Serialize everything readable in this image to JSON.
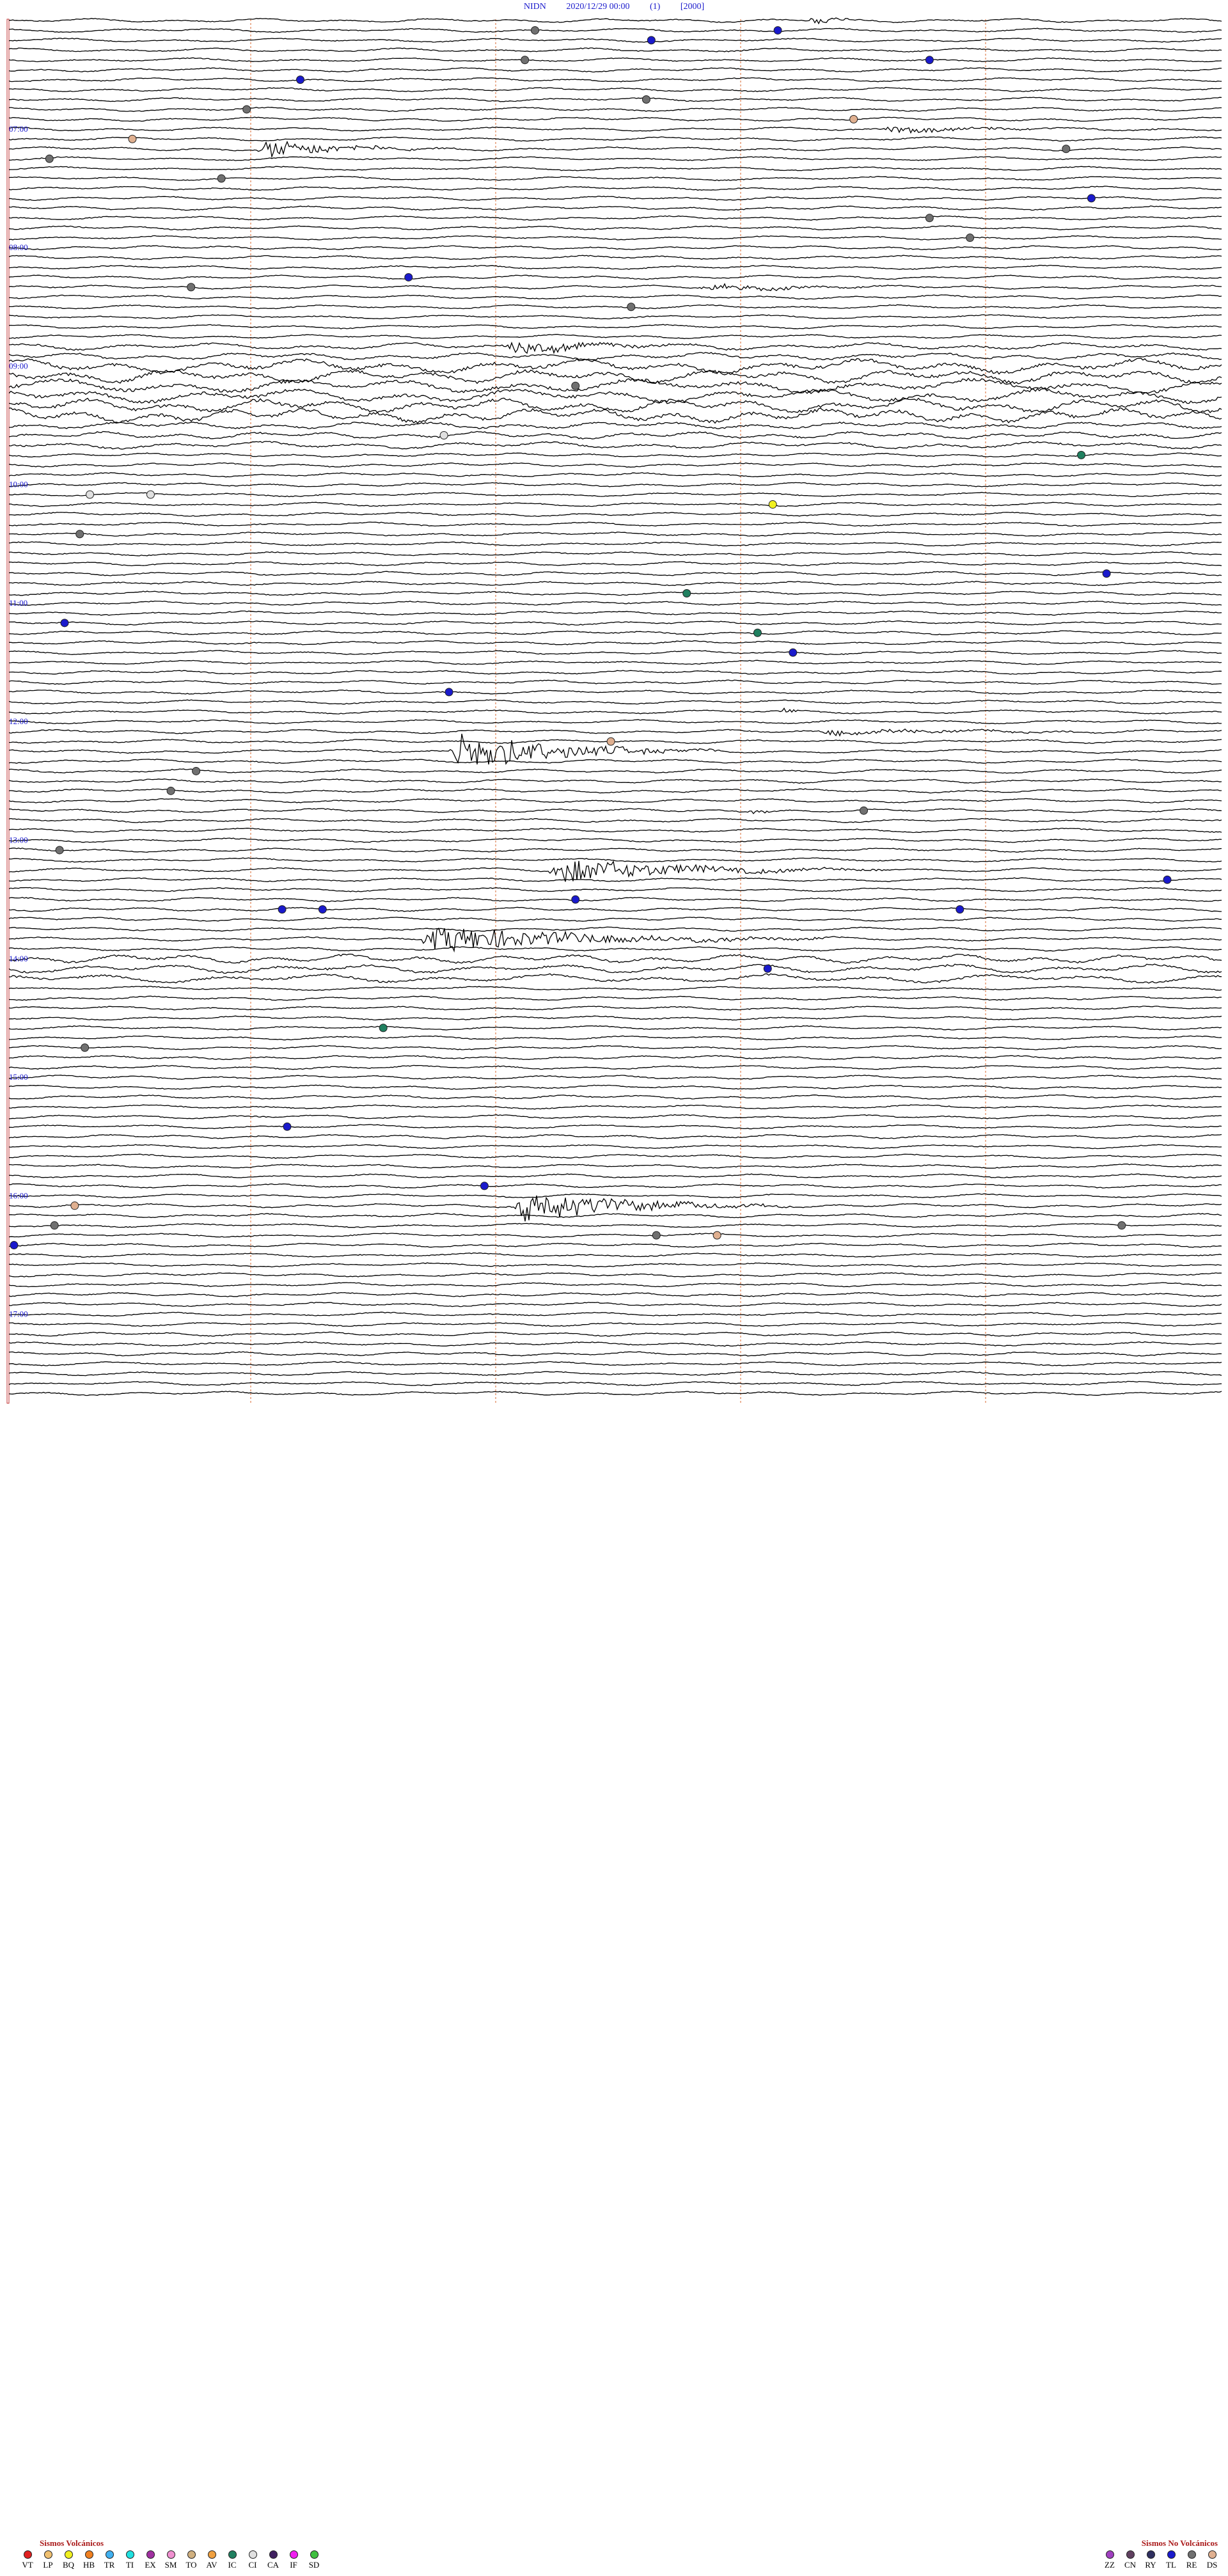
{
  "header": {
    "station": "NIDN",
    "datetime": "2020/12/29 00:00",
    "channel": "(1)",
    "scale": "[2000]"
  },
  "hour_labels": [
    {
      "label": "07:00",
      "row": 11
    },
    {
      "label": "08:00",
      "row": 23
    },
    {
      "label": "09:00",
      "row": 35
    },
    {
      "label": "10:00",
      "row": 47
    },
    {
      "label": "11:00",
      "row": 59
    },
    {
      "label": "12:00",
      "row": 71
    },
    {
      "label": "13:00",
      "row": 83
    },
    {
      "label": "14:00",
      "row": 95
    },
    {
      "label": "15:00",
      "row": 107
    },
    {
      "label": "16:00",
      "row": 119
    },
    {
      "label": "17:00",
      "row": 131
    }
  ],
  "legend": {
    "volcanic": {
      "title": "Sismos Volcánicos",
      "items": [
        {
          "code": "VT",
          "color": "#e02020"
        },
        {
          "code": "LP",
          "color": "#f0c070"
        },
        {
          "code": "BQ",
          "color": "#f0f020"
        },
        {
          "code": "HB",
          "color": "#f08020"
        },
        {
          "code": "TR",
          "color": "#40b0f0"
        },
        {
          "code": "TI",
          "color": "#20e0e0"
        },
        {
          "code": "EX",
          "color": "#a030a0"
        },
        {
          "code": "SM",
          "color": "#f090d0"
        },
        {
          "code": "TO",
          "color": "#d0b080"
        },
        {
          "code": "AV",
          "color": "#f0a040"
        },
        {
          "code": "IC",
          "color": "#208060"
        },
        {
          "code": "CI",
          "color": "#e0e0e0"
        },
        {
          "code": "CA",
          "color": "#402060"
        },
        {
          "code": "IF",
          "color": "#f020f0"
        },
        {
          "code": "SD",
          "color": "#40c040"
        }
      ]
    },
    "non_volcanic": {
      "title": "Sismos No Volcánicos",
      "items": [
        {
          "code": "ZZ",
          "color": "#a040c0"
        },
        {
          "code": "CN",
          "color": "#604060"
        },
        {
          "code": "RY",
          "color": "#303060"
        },
        {
          "code": "TL",
          "color": "#1a1acc"
        },
        {
          "code": "RE",
          "color": "#707070"
        },
        {
          "code": "DS",
          "color": "#e0b090"
        }
      ]
    }
  },
  "markers": [
    {
      "row": 1,
      "minute": 52.0,
      "type": "RE"
    },
    {
      "row": 1,
      "minute": 76.0,
      "type": "TL"
    },
    {
      "row": 2,
      "minute": 63.5,
      "type": "TL"
    },
    {
      "row": 4,
      "minute": 51.0,
      "type": "RE"
    },
    {
      "row": 4,
      "minute": 91.0,
      "type": "TL"
    },
    {
      "row": 6,
      "minute": 28.8,
      "type": "TL"
    },
    {
      "row": 8,
      "minute": 63.0,
      "type": "RE"
    },
    {
      "row": 9,
      "minute": 23.5,
      "type": "RE"
    },
    {
      "row": 10,
      "minute": 83.5,
      "type": "DS"
    },
    {
      "row": 12,
      "minute": 12.2,
      "type": "DS"
    },
    {
      "row": 13,
      "minute": 104.5,
      "type": "RE"
    },
    {
      "row": 14,
      "minute": 4.0,
      "type": "RE"
    },
    {
      "row": 16,
      "minute": 21.0,
      "type": "RE"
    },
    {
      "row": 18,
      "minute": 107.0,
      "type": "TL"
    },
    {
      "row": 20,
      "minute": 91.0,
      "type": "RE"
    },
    {
      "row": 22,
      "minute": 95.0,
      "type": "RE"
    },
    {
      "row": 26,
      "minute": 39.5,
      "type": "TL"
    },
    {
      "row": 27,
      "minute": 18.0,
      "type": "RE"
    },
    {
      "row": 29,
      "minute": 61.5,
      "type": "RE"
    },
    {
      "row": 37,
      "minute": 56.0,
      "type": "RE"
    },
    {
      "row": 42,
      "minute": 43.0,
      "type": "CI"
    },
    {
      "row": 44,
      "minute": 106.0,
      "type": "IC"
    },
    {
      "row": 48,
      "minute": 8.0,
      "type": "CI"
    },
    {
      "row": 48,
      "minute": 14.0,
      "type": "CI"
    },
    {
      "row": 49,
      "minute": 75.5,
      "type": "BQ"
    },
    {
      "row": 52,
      "minute": 7.0,
      "type": "RE"
    },
    {
      "row": 56,
      "minute": 108.5,
      "type": "TL"
    },
    {
      "row": 58,
      "minute": 67.0,
      "type": "IC"
    },
    {
      "row": 61,
      "minute": 5.5,
      "type": "TL"
    },
    {
      "row": 62,
      "minute": 74.0,
      "type": "IC"
    },
    {
      "row": 64,
      "minute": 77.5,
      "type": "TL"
    },
    {
      "row": 68,
      "minute": 43.5,
      "type": "TL"
    },
    {
      "row": 73,
      "minute": 59.5,
      "type": "DS"
    },
    {
      "row": 76,
      "minute": 18.5,
      "type": "RE"
    },
    {
      "row": 78,
      "minute": 16.0,
      "type": "RE"
    },
    {
      "row": 80,
      "minute": 84.5,
      "type": "RE"
    },
    {
      "row": 84,
      "minute": 5.0,
      "type": "RE"
    },
    {
      "row": 87,
      "minute": 114.5,
      "type": "TL"
    },
    {
      "row": 89,
      "minute": 56.0,
      "type": "TL"
    },
    {
      "row": 90,
      "minute": 27.0,
      "type": "TL"
    },
    {
      "row": 90,
      "minute": 31.0,
      "type": "TL"
    },
    {
      "row": 90,
      "minute": 94.0,
      "type": "TL"
    },
    {
      "row": 96,
      "minute": 75.0,
      "type": "TL"
    },
    {
      "row": 102,
      "minute": 37.0,
      "type": "IC"
    },
    {
      "row": 104,
      "minute": 7.5,
      "type": "RE"
    },
    {
      "row": 112,
      "minute": 27.5,
      "type": "TL"
    },
    {
      "row": 118,
      "minute": 47.0,
      "type": "TL"
    },
    {
      "row": 120,
      "minute": 6.5,
      "type": "DS"
    },
    {
      "row": 122,
      "minute": 4.5,
      "type": "RE"
    },
    {
      "row": 122,
      "minute": 110.0,
      "type": "RE"
    },
    {
      "row": 123,
      "minute": 64.0,
      "type": "RE"
    },
    {
      "row": 123,
      "minute": 70.0,
      "type": "DS"
    },
    {
      "row": 124,
      "minute": 0.5,
      "type": "TL"
    }
  ],
  "events": [
    {
      "row": 0,
      "minute": 79.0,
      "duration": 8.0,
      "amp": 0.6
    },
    {
      "row": 11,
      "minute": 86.0,
      "duration": 28.0,
      "amp": 0.5
    },
    {
      "row": 13,
      "minute": 24.5,
      "duration": 20.0,
      "amp": 1.4
    },
    {
      "row": 27,
      "minute": 68.0,
      "duration": 25.0,
      "amp": 0.5
    },
    {
      "row": 33,
      "minute": 49.0,
      "duration": 22.0,
      "amp": 1.0
    },
    {
      "row": 70,
      "minute": 76.0,
      "duration": 4.0,
      "amp": 0.6
    },
    {
      "row": 72,
      "minute": 79.5,
      "duration": 40.0,
      "amp": 0.4
    },
    {
      "row": 74,
      "minute": 43.5,
      "duration": 27.0,
      "amp": 3.0
    },
    {
      "row": 80,
      "minute": 73.0,
      "duration": 8.0,
      "amp": 0.3
    },
    {
      "row": 86,
      "minute": 53.0,
      "duration": 34.0,
      "amp": 1.8
    },
    {
      "row": 93,
      "minute": 40.5,
      "duration": 42.0,
      "amp": 2.0
    },
    {
      "row": 120,
      "minute": 49.5,
      "duration": 28.0,
      "amp": 2.5
    }
  ],
  "noisy_rows": [
    {
      "from": 33,
      "to": 35,
      "amp": 1.8
    },
    {
      "from": 35,
      "to": 41,
      "amp": 3.5
    },
    {
      "from": 41,
      "to": 44,
      "amp": 1.8
    },
    {
      "from": 95,
      "to": 98,
      "amp": 2.2
    }
  ]
}
